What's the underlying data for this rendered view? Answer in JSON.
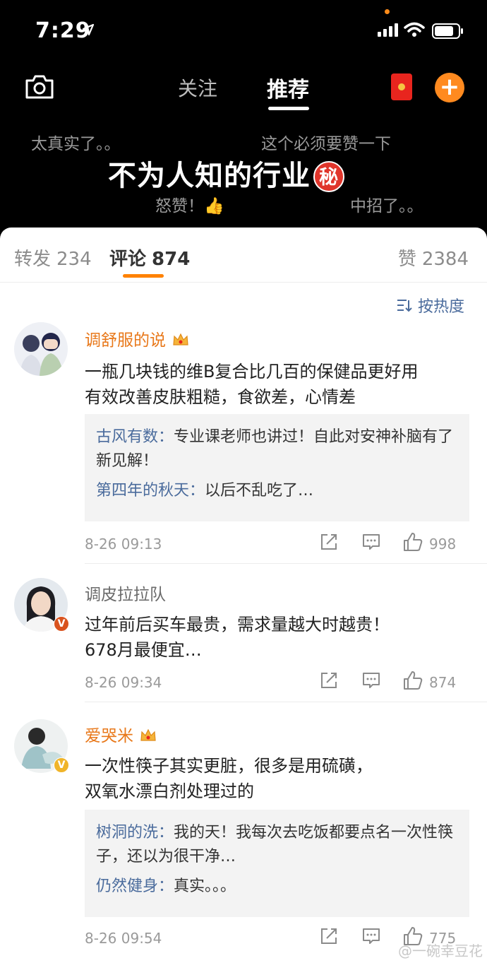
{
  "status_bar": {
    "time": "7:29"
  },
  "header": {
    "tabs": [
      {
        "label": "关注"
      },
      {
        "label": "推荐"
      }
    ],
    "active_tab": "推荐"
  },
  "video": {
    "title": "不为人知的行业",
    "badge": "秘",
    "danmaku": [
      "太真实了。。",
      "这个必须要赞一下",
      "怒赞！👍",
      "中招了。。"
    ]
  },
  "sheet": {
    "tabs": {
      "repost": {
        "label": "转发",
        "count": "234"
      },
      "comment": {
        "label": "评论",
        "count": "874"
      },
      "like": {
        "label": "赞",
        "count": "2384"
      }
    },
    "sort_label": "按热度"
  },
  "comments": [
    {
      "user": "调舒服的说",
      "text_lines": [
        "一瓶几块钱的维B复合比几百的保健品更好用",
        "有效改善皮肤粗糙，食欲差，心情差"
      ],
      "replies": [
        {
          "user": "古风有数：",
          "text": "专业课老师也讲过！自此对安神补脑有了新见解！"
        },
        {
          "user": "第四年的秋天：",
          "text": "以后不乱吃了…"
        }
      ],
      "date": "8-26 09:13",
      "likes": "998"
    },
    {
      "user": "调皮拉拉队",
      "text_lines": [
        "过年前后买车最贵，需求量越大时越贵！",
        "678月最便宜…"
      ],
      "replies": [],
      "date": "8-26 09:34",
      "likes": "874"
    },
    {
      "user": "爱哭米",
      "text_lines": [
        "一次性筷子其实更脏，很多是用硫磺，",
        "双氧水漂白剂处理过的"
      ],
      "replies": [
        {
          "user": "树洞的洗：",
          "text": "我的天！我每次去吃饭都要点名一次性筷子，还以为很干净…"
        },
        {
          "user": "仍然健身：",
          "text": "真实。。。"
        }
      ],
      "date": "8-26 09:54",
      "likes": "775"
    }
  ],
  "watermark": "@一碗幸豆花",
  "colors": {
    "accent": "#ff8200",
    "link": "#4a6b9c",
    "badge_red": "#e0352b"
  }
}
